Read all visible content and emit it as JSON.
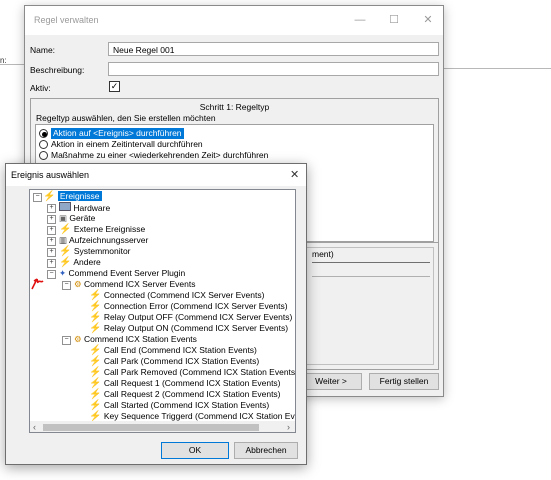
{
  "background": {
    "colon": "n:"
  },
  "main_window": {
    "title": "Regel verwalten",
    "controls": {
      "minimize": "—",
      "maximize": "☐",
      "close": "✕"
    },
    "name_label": "Name:",
    "name_value": "Neue Regel 001",
    "description_label": "Beschreibung:",
    "description_value": "",
    "active_label": "Aktiv:",
    "active_checked": "✓",
    "step_title": "Schritt 1: Regeltyp",
    "step_instruction": "Regeltyp auswählen, den Sie erstellen möchten",
    "rule_types": [
      "Aktion auf <Ereignis> durchführen",
      "Aktion in einem Zeitintervall durchführen",
      "Maßnahme zu einer <wiederkehrenden Zeit> durchführen"
    ],
    "partial_text": "ment)",
    "next_button": "Weiter >",
    "finish_button": "Fertig stellen"
  },
  "dialog": {
    "title": "Ereignis auswählen",
    "close": "✕",
    "tree": {
      "root": "Ereignisse",
      "items": [
        "Hardware",
        "Geräte",
        "Externe Ereignisse",
        "Aufzeichnungsserver",
        "Systemmonitor",
        "Andere",
        "Commend Event Server Plugin"
      ],
      "server_group": "Commend ICX Server Events",
      "server_events": [
        "Connected (Commend ICX Server Events)",
        "Connection Error (Commend ICX Server Events)",
        "Relay Output OFF (Commend ICX Server Events)",
        "Relay Output ON (Commend ICX Server Events)"
      ],
      "station_group": "Commend ICX Station Events",
      "station_events": [
        "Call End (Commend ICX Station Events)",
        "Call Park (Commend ICX Station Events)",
        "Call Park Removed (Commend ICX Station Events)",
        "Call Request 1 (Commend ICX Station Events)",
        "Call Request 2 (Commend ICX Station Events)",
        "Call Started (Commend ICX Station Events)",
        "Key Sequence Triggerd (Commend ICX Station Events)"
      ]
    },
    "ok_button": "OK",
    "cancel_button": "Abbrechen"
  },
  "colors": {
    "accent": "#0078d7",
    "bolt": "#e8b100",
    "annotation_arrow": "#e01010"
  }
}
